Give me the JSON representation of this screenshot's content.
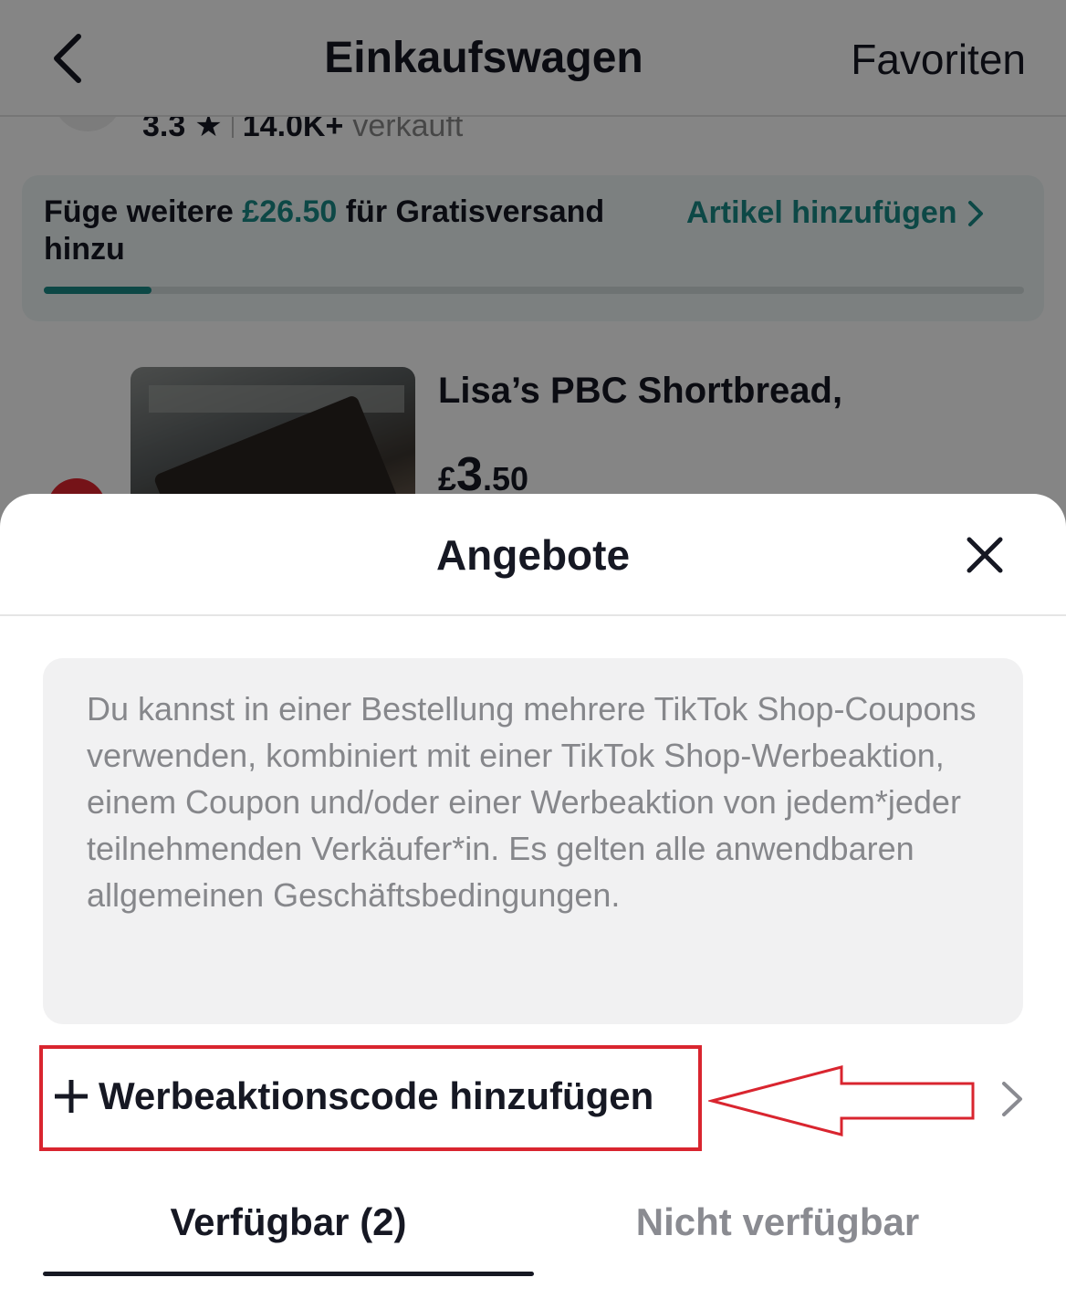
{
  "navbar": {
    "title": "Einkaufswagen",
    "favorites_label": "Favoriten",
    "back_icon": "chevron-left-icon"
  },
  "shop": {
    "rating": "3.3",
    "sold_count": "14.0K+",
    "sold_label": "verkauft"
  },
  "shipping_banner": {
    "text_before": "Füge weitere ",
    "amount": "£26.50",
    "text_after": " für Gratisversand hinzu",
    "link_label": "Artikel hinzufügen",
    "progress": 0.11,
    "accent_color": "#1a8a87"
  },
  "product": {
    "title": "Lisa’s PBC Shortbread,",
    "currency": "£",
    "price_whole": "3",
    "price_fraction": ".50"
  },
  "sheet": {
    "title": "Angebote",
    "close_icon": "close-icon",
    "info_text": "Du kannst in einer Bestellung mehrere TikTok Shop-Coupons verwenden, kombiniert mit einer TikTok Shop-Werbeaktion, einem Coupon und/oder einer Werbeaktion von jedem*jeder teilnehmenden Verkäufer*in. Es gelten alle anwendbaren allgemeinen Geschäftsbedingungen.",
    "promo_code_label": "Werbeaktionscode hinzufügen",
    "highlight_color": "#d9252f",
    "tabs": [
      {
        "label": "Verfügbar (2)",
        "selected": true
      },
      {
        "label": "Nicht verfügbar",
        "selected": false
      }
    ]
  }
}
